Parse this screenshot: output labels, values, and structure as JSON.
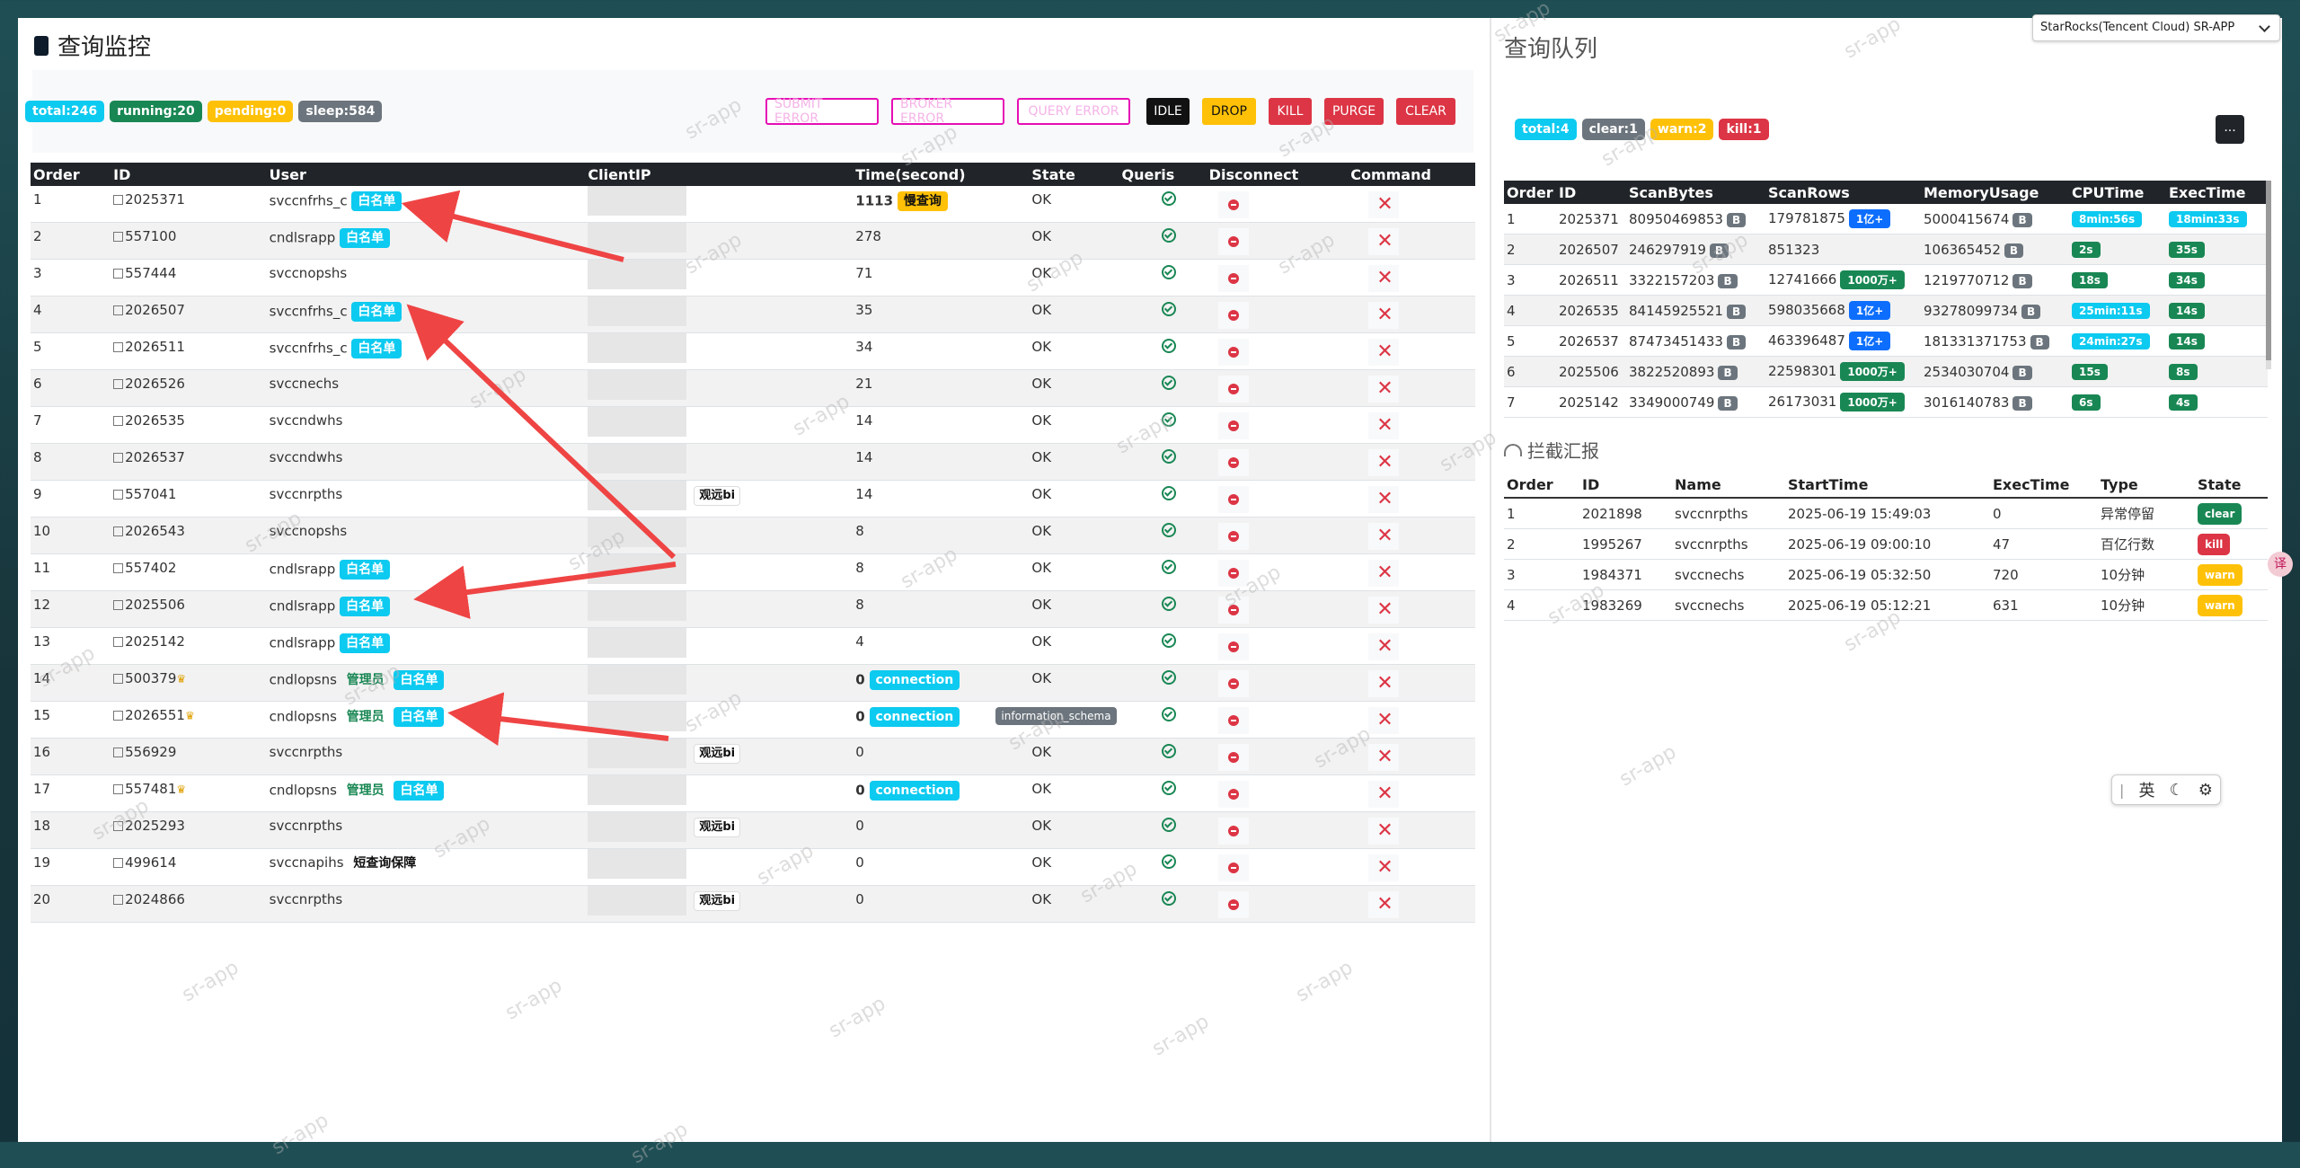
{
  "left": {
    "title": "查询监控",
    "stats": [
      {
        "label": "total:246",
        "color": "#0dcaf0"
      },
      {
        "label": "running:20",
        "color": "#198754"
      },
      {
        "label": "pending:0",
        "color": "#ffc107"
      },
      {
        "label": "sleep:584",
        "color": "#6c757d"
      }
    ],
    "buttons": {
      "submit_error": "SUBMIT ERROR",
      "broker_error": "BROKER ERROR",
      "query_error": "QUERY ERROR",
      "idle": "IDLE",
      "drop": "DROP",
      "kill": "KILL",
      "purge": "PURGE",
      "clear": "CLEAR"
    },
    "columns": [
      "Order",
      "ID",
      "User",
      "ClientIP",
      "Time(second)",
      "State",
      "Queris",
      "Disconnect",
      "Command"
    ],
    "rows": [
      {
        "order": "1",
        "id": "2025371",
        "user": "svccnfrhs_c",
        "white": "白名单",
        "admin": "",
        "short": "",
        "crown": false,
        "tag": "",
        "time": "1113",
        "time_tag": "慢查询",
        "state": "OK",
        "schema": ""
      },
      {
        "order": "2",
        "id": "557100",
        "user": "cndlsrapp",
        "white": "白名单",
        "admin": "",
        "short": "",
        "crown": false,
        "tag": "",
        "time": "278",
        "time_tag": "",
        "state": "OK",
        "schema": ""
      },
      {
        "order": "3",
        "id": "557444",
        "user": "svccnopshs",
        "white": "",
        "admin": "",
        "short": "",
        "crown": false,
        "tag": "",
        "time": "71",
        "time_tag": "",
        "state": "OK",
        "schema": ""
      },
      {
        "order": "4",
        "id": "2026507",
        "user": "svccnfrhs_c",
        "white": "白名单",
        "admin": "",
        "short": "",
        "crown": false,
        "tag": "",
        "time": "35",
        "time_tag": "",
        "state": "OK",
        "schema": ""
      },
      {
        "order": "5",
        "id": "2026511",
        "user": "svccnfrhs_c",
        "white": "白名单",
        "admin": "",
        "short": "",
        "crown": false,
        "tag": "",
        "time": "34",
        "time_tag": "",
        "state": "OK",
        "schema": ""
      },
      {
        "order": "6",
        "id": "2026526",
        "user": "svccnechs",
        "white": "",
        "admin": "",
        "short": "",
        "crown": false,
        "tag": "",
        "time": "21",
        "time_tag": "",
        "state": "OK",
        "schema": ""
      },
      {
        "order": "7",
        "id": "2026535",
        "user": "svccndwhs",
        "white": "",
        "admin": "",
        "short": "",
        "crown": false,
        "tag": "",
        "time": "14",
        "time_tag": "",
        "state": "OK",
        "schema": ""
      },
      {
        "order": "8",
        "id": "2026537",
        "user": "svccndwhs",
        "white": "",
        "admin": "",
        "short": "",
        "crown": false,
        "tag": "",
        "time": "14",
        "time_tag": "",
        "state": "OK",
        "schema": ""
      },
      {
        "order": "9",
        "id": "557041",
        "user": "svccnrpths",
        "white": "",
        "admin": "",
        "short": "",
        "crown": false,
        "tag": "观远bi",
        "time": "14",
        "time_tag": "",
        "state": "OK",
        "schema": ""
      },
      {
        "order": "10",
        "id": "2026543",
        "user": "svccnopshs",
        "white": "",
        "admin": "",
        "short": "",
        "crown": false,
        "tag": "",
        "time": "8",
        "time_tag": "",
        "state": "OK",
        "schema": ""
      },
      {
        "order": "11",
        "id": "557402",
        "user": "cndlsrapp",
        "white": "白名单",
        "admin": "",
        "short": "",
        "crown": false,
        "tag": "",
        "time": "8",
        "time_tag": "",
        "state": "OK",
        "schema": ""
      },
      {
        "order": "12",
        "id": "2025506",
        "user": "cndlsrapp",
        "white": "白名单",
        "admin": "",
        "short": "",
        "crown": false,
        "tag": "",
        "time": "8",
        "time_tag": "",
        "state": "OK",
        "schema": ""
      },
      {
        "order": "13",
        "id": "2025142",
        "user": "cndlsrapp",
        "white": "白名单",
        "admin": "",
        "short": "",
        "crown": false,
        "tag": "",
        "time": "4",
        "time_tag": "",
        "state": "OK",
        "schema": ""
      },
      {
        "order": "14",
        "id": "500379",
        "user": "cndlopsns",
        "white": "白名单",
        "admin": "管理员",
        "short": "",
        "crown": true,
        "tag": "",
        "time": "0",
        "time_tag": "connection",
        "state": "OK",
        "schema": ""
      },
      {
        "order": "15",
        "id": "2026551",
        "user": "cndlopsns",
        "white": "白名单",
        "admin": "管理员",
        "short": "",
        "crown": true,
        "tag": "",
        "time": "0",
        "time_tag": "connection",
        "state": "",
        "schema": "information_schema"
      },
      {
        "order": "16",
        "id": "556929",
        "user": "svccnrpths",
        "white": "",
        "admin": "",
        "short": "",
        "crown": false,
        "tag": "观远bi",
        "time": "0",
        "time_tag": "",
        "state": "OK",
        "schema": ""
      },
      {
        "order": "17",
        "id": "557481",
        "user": "cndlopsns",
        "white": "白名单",
        "admin": "管理员",
        "short": "",
        "crown": true,
        "tag": "",
        "time": "0",
        "time_tag": "connection",
        "state": "OK",
        "schema": ""
      },
      {
        "order": "18",
        "id": "2025293",
        "user": "svccnrpths",
        "white": "",
        "admin": "",
        "short": "",
        "crown": false,
        "tag": "观远bi",
        "time": "0",
        "time_tag": "",
        "state": "OK",
        "schema": ""
      },
      {
        "order": "19",
        "id": "499614",
        "user": "svccnapihs",
        "white": "",
        "admin": "",
        "short": "短查询保障",
        "crown": false,
        "tag": "",
        "time": "0",
        "time_tag": "",
        "state": "OK",
        "schema": ""
      },
      {
        "order": "20",
        "id": "2024866",
        "user": "svccnrpths",
        "white": "",
        "admin": "",
        "short": "",
        "crown": false,
        "tag": "观远bi",
        "time": "0",
        "time_tag": "",
        "state": "OK",
        "schema": ""
      }
    ]
  },
  "right": {
    "title": "查询队列",
    "cluster_select": "StarRocks(Tencent Cloud) SR-APP",
    "stats": [
      {
        "label": "total:4",
        "color": "#0dcaf0"
      },
      {
        "label": "clear:1",
        "color": "#6c757d"
      },
      {
        "label": "warn:2",
        "color": "#ffc107"
      },
      {
        "label": "kill:1",
        "color": "#dc3545"
      }
    ],
    "more_button": "...",
    "columns": [
      "Order",
      "ID",
      "ScanBytes",
      "ScanRows",
      "MemoryUsage",
      "CPUTime",
      "ExecTime"
    ],
    "rows": [
      {
        "order": "1",
        "id": "2025371",
        "bytes": "80950469853",
        "rows": "179781875",
        "rows_tag": "1亿+",
        "rows_tag_type": "p",
        "mem": "5000415674",
        "cpu": "8min:56s",
        "cpu_type": "c",
        "exec": "18min:33s",
        "exec_type": "c"
      },
      {
        "order": "2",
        "id": "2026507",
        "bytes": "246297919",
        "rows": "851323",
        "rows_tag": "",
        "rows_tag_type": "",
        "mem": "106365452",
        "cpu": "2s",
        "cpu_type": "g",
        "exec": "35s",
        "exec_type": "g"
      },
      {
        "order": "3",
        "id": "2026511",
        "bytes": "3322157203",
        "rows": "12741666",
        "rows_tag": "1000万+",
        "rows_tag_type": "g",
        "mem": "1219770712",
        "cpu": "18s",
        "cpu_type": "g",
        "exec": "34s",
        "exec_type": "g"
      },
      {
        "order": "4",
        "id": "2026535",
        "bytes": "84145925521",
        "rows": "598035668",
        "rows_tag": "1亿+",
        "rows_tag_type": "p",
        "mem": "93278099734",
        "cpu": "25min:11s",
        "cpu_type": "c",
        "exec": "14s",
        "exec_type": "g"
      },
      {
        "order": "5",
        "id": "2026537",
        "bytes": "87473451433",
        "rows": "463396487",
        "rows_tag": "1亿+",
        "rows_tag_type": "p",
        "mem": "181331371753",
        "cpu": "24min:27s",
        "cpu_type": "c",
        "exec": "14s",
        "exec_type": "g"
      },
      {
        "order": "6",
        "id": "2025506",
        "bytes": "3822520893",
        "rows": "22598301",
        "rows_tag": "1000万+",
        "rows_tag_type": "g",
        "mem": "2534030704",
        "cpu": "15s",
        "cpu_type": "g",
        "exec": "8s",
        "exec_type": "g"
      },
      {
        "order": "7",
        "id": "2025142",
        "bytes": "3349000749",
        "rows": "26173031",
        "rows_tag": "1000万+",
        "rows_tag_type": "g",
        "mem": "3016140783",
        "cpu": "6s",
        "cpu_type": "g",
        "exec": "4s",
        "exec_type": "g"
      }
    ],
    "b_label": "B",
    "intercept": {
      "title": "拦截汇报",
      "columns": [
        "Order",
        "ID",
        "Name",
        "StartTime",
        "ExecTime",
        "Type",
        "State"
      ],
      "rows": [
        {
          "order": "1",
          "id": "2021898",
          "name": "svccnrpths",
          "start": "2025-06-19 15:49:03",
          "exec": "0",
          "type": "异常停留",
          "state": "clear",
          "color": "#198754"
        },
        {
          "order": "2",
          "id": "1995267",
          "name": "svccnrpths",
          "start": "2025-06-19 09:00:10",
          "exec": "47",
          "type": "百亿行数",
          "state": "kill",
          "color": "#dc3545"
        },
        {
          "order": "3",
          "id": "1984371",
          "name": "svccnechs",
          "start": "2025-06-19 05:32:50",
          "exec": "720",
          "type": "10分钟",
          "state": "warn",
          "color": "#ffc107"
        },
        {
          "order": "4",
          "id": "1983269",
          "name": "svccnechs",
          "start": "2025-06-19 05:12:21",
          "exec": "631",
          "type": "10分钟",
          "state": "warn",
          "color": "#ffc107"
        }
      ]
    }
  },
  "ime": {
    "mode_label": "英",
    "pipe": "|"
  },
  "side_float_label": "译",
  "watermark": "sr-app"
}
